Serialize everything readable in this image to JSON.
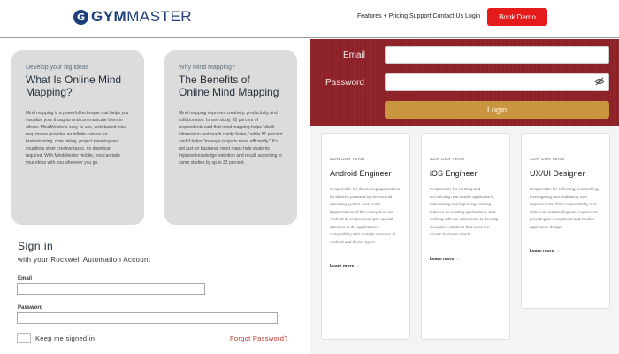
{
  "header": {
    "logo_mark": "G",
    "logo_text_bold": "GYM",
    "logo_text_rest": "MASTER",
    "nav_items": [
      "Features",
      "Pricing",
      "Support",
      "Contact Us",
      "Login"
    ],
    "nav_plus": "+",
    "book_demo": "Book Demo"
  },
  "mind_map": {
    "cards": [
      {
        "kicker": "Develop your big ideas",
        "title": "What Is Online Mind Mapping?",
        "body": "Mind mapping is a powerful technique that helps you visualize your thoughts and communicate them to others. MindMeister's easy-to-use, web-based mind map maker provides an infinite canvas for brainstorming, note taking, project planning and countless other creative tasks, no download required. With MindMeister mobile, you can take your ideas with you wherever you go."
      },
      {
        "kicker": "Why Mind Mapping?",
        "title": "The Benefits of Online Mind Mapping",
        "body": "Mind mapping improves creativity, productivity and collaboration. In one study, 92 percent of respondents said that mind mapping helps \"distill information and reach clarity faster,\" while 81 percent said it helps \"manage projects more efficiently.\" It's not just for business: mind maps help students improve knowledge retention and recall, according to some studies by up to 32 percent."
      }
    ]
  },
  "signin": {
    "title": "Sign in",
    "subtitle": "with your Rockwell Automation Account",
    "email_label": "Email",
    "password_label": "Password",
    "keep_signed_in": "Keep me signed in",
    "forgot": "Forgot Password?"
  },
  "login_panel": {
    "email_label": "Email",
    "password_label": "Password",
    "login_button": "Login"
  },
  "jobs": [
    {
      "kicker": "JOIN OUR TEAM",
      "title": "Android Engineer",
      "desc": "Responsible for developing applications for devices powered by the Android operating system. Due to the fragmentation of this ecosystem, an Android developer must pay special attention to the application's compatibility with multiple versions of Android and device types.",
      "link": "Learn more",
      "arrow": "→"
    },
    {
      "kicker": "JOIN OUR TEAM",
      "title": "iOS Engineer",
      "desc": "Responsible for creating and architecting new mobile applications, maintaining and improving existing features on existing applications, and working with our sales team to develop innovative solutions that meet our clients' business needs.",
      "link": "Learn more",
      "arrow": "→"
    },
    {
      "kicker": "JOIN OUR TEAM",
      "title": "UX/UI Designer",
      "desc": "Responsible for collecting, researching, investigating and evaluating user requirements. Their responsibility is to deliver an outstanding user experience providing an exceptional and intuitive application design.",
      "link": "Learn more",
      "arrow": "→"
    }
  ],
  "colors": {
    "brand_blue": "#1d3e7a",
    "book_red": "#e51b1b",
    "panel_maroon": "#8e1f26",
    "login_gold": "#c9953f",
    "forgot_red": "#c0392b",
    "link_blue": "#1e78d2"
  },
  "icons": [
    "gymmaster-logo-icon",
    "eye-slash-icon",
    "arrow-right-icon"
  ]
}
